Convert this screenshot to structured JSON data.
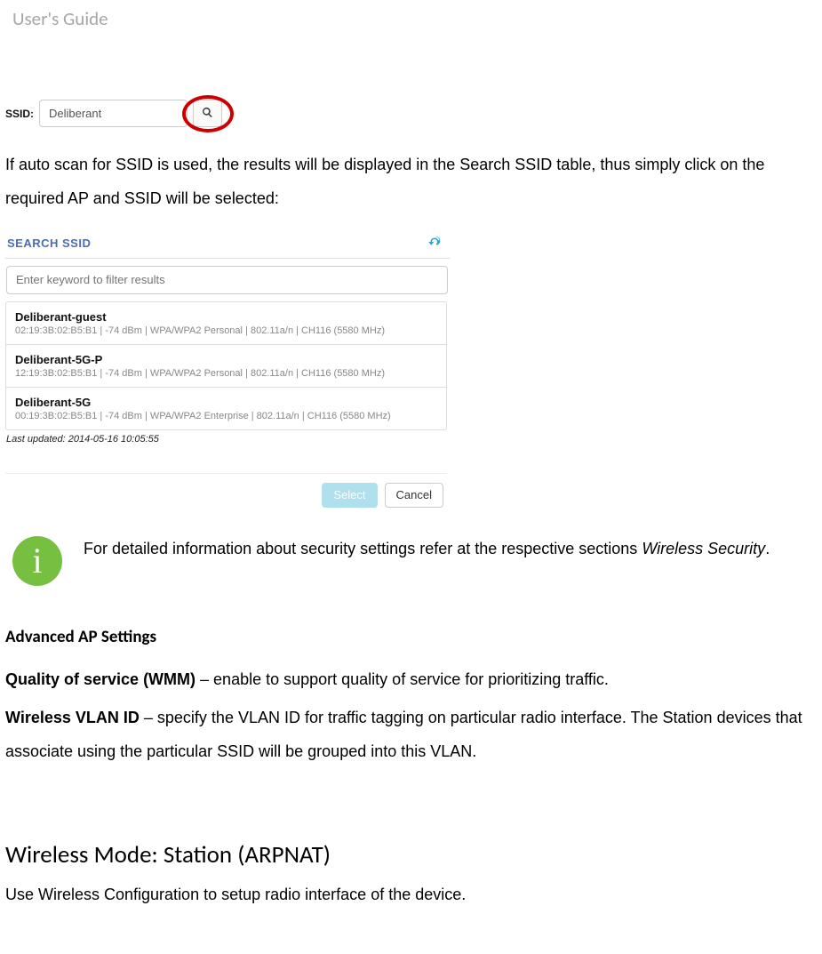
{
  "header": {
    "title": "User's Guide"
  },
  "ssid_field": {
    "label": "SSID:",
    "value": "Deliberant"
  },
  "intro_text": "If auto scan for SSID is used, the results will be displayed in the Search SSID table, thus simply click on the required AP and SSID will be selected:",
  "search_panel": {
    "title": "SEARCH SSID",
    "filter_placeholder": "Enter keyword to filter results",
    "results": [
      {
        "name": "Deliberant-guest",
        "detail": "02:19:3B:02:B5:B1 | -74 dBm | WPA/WPA2 Personal | 802.11a/n | CH116 (5580 MHz)"
      },
      {
        "name": "Deliberant-5G-P",
        "detail": "12:19:3B:02:B5:B1 | -74 dBm | WPA/WPA2 Personal | 802.11a/n | CH116 (5580 MHz)"
      },
      {
        "name": "Deliberant-5G",
        "detail": "00:19:3B:02:B5:B1 | -74 dBm | WPA/WPA2 Enterprise | 802.11a/n | CH116 (5580 MHz)"
      }
    ],
    "last_updated": "Last updated: 2014-05-16 10:05:55",
    "select_label": "Select",
    "cancel_label": "Cancel"
  },
  "info_note": {
    "pre": "For detailed information about security settings refer at the respective sections ",
    "ital": "Wireless Security",
    "post": "."
  },
  "advanced_heading": "Advanced AP Settings",
  "wmm": {
    "label": "Quality of service (WMM)",
    "text": " – enable to support quality of service for prioritizing traffic."
  },
  "vlan": {
    "label": "Wireless VLAN ID",
    "text": " – specify the VLAN ID for traffic tagging on particular radio interface. The Station devices that associate using the particular SSID will be grouped into this VLAN."
  },
  "station_heading": "Wireless Mode: Station (ARPNAT)",
  "closing_text": "Use Wireless Configuration to setup radio interface of the device."
}
